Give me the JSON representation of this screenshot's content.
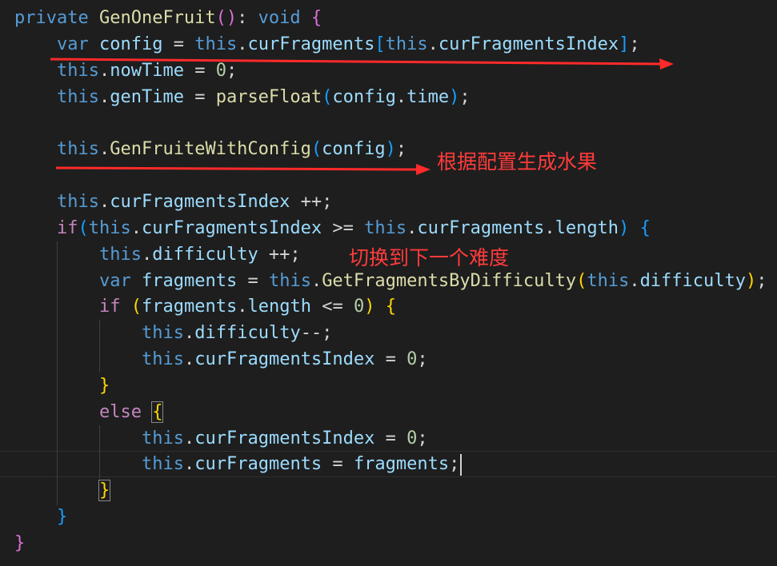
{
  "editor": {
    "lines": [
      {
        "indent": 0,
        "tokens": [
          [
            "private ",
            "kw"
          ],
          [
            "GenOneFruit",
            "fn"
          ],
          [
            "(",
            "b2"
          ],
          [
            ")",
            "b2"
          ],
          [
            ": ",
            "op"
          ],
          [
            "void ",
            "kw"
          ],
          [
            "{",
            "b2"
          ]
        ]
      },
      {
        "indent": 1,
        "tokens": [
          [
            "var ",
            "kw"
          ],
          [
            "config",
            "var"
          ],
          [
            " = ",
            "op"
          ],
          [
            "this",
            "kw"
          ],
          [
            ".",
            "op"
          ],
          [
            "curFragments",
            "var"
          ],
          [
            "[",
            "b3"
          ],
          [
            "this",
            "kw"
          ],
          [
            ".",
            "op"
          ],
          [
            "curFragmentsIndex",
            "var"
          ],
          [
            "]",
            "b3"
          ],
          [
            ";",
            "op"
          ]
        ]
      },
      {
        "indent": 1,
        "tokens": [
          [
            "this",
            "kw"
          ],
          [
            ".",
            "op"
          ],
          [
            "nowTime",
            "var"
          ],
          [
            " = ",
            "op"
          ],
          [
            "0",
            "num"
          ],
          [
            ";",
            "op"
          ]
        ]
      },
      {
        "indent": 1,
        "tokens": [
          [
            "this",
            "kw"
          ],
          [
            ".",
            "op"
          ],
          [
            "genTime",
            "var"
          ],
          [
            " = ",
            "op"
          ],
          [
            "parseFloat",
            "fn"
          ],
          [
            "(",
            "b3"
          ],
          [
            "config",
            "var"
          ],
          [
            ".",
            "op"
          ],
          [
            "time",
            "var"
          ],
          [
            ")",
            "b3"
          ],
          [
            ";",
            "op"
          ]
        ]
      },
      {
        "indent": 0,
        "tokens": []
      },
      {
        "indent": 1,
        "tokens": [
          [
            "this",
            "kw"
          ],
          [
            ".",
            "op"
          ],
          [
            "GenFruiteWithConfig",
            "fn"
          ],
          [
            "(",
            "b3"
          ],
          [
            "config",
            "var"
          ],
          [
            ")",
            "b3"
          ],
          [
            ";",
            "op"
          ]
        ]
      },
      {
        "indent": 0,
        "tokens": []
      },
      {
        "indent": 1,
        "tokens": [
          [
            "this",
            "kw"
          ],
          [
            ".",
            "op"
          ],
          [
            "curFragmentsIndex",
            "var"
          ],
          [
            " ++;",
            "op"
          ]
        ]
      },
      {
        "indent": 1,
        "tokens": [
          [
            "if",
            "ctl"
          ],
          [
            "(",
            "b3"
          ],
          [
            "this",
            "kw"
          ],
          [
            ".",
            "op"
          ],
          [
            "curFragmentsIndex",
            "var"
          ],
          [
            " >= ",
            "op"
          ],
          [
            "this",
            "kw"
          ],
          [
            ".",
            "op"
          ],
          [
            "curFragments",
            "var"
          ],
          [
            ".",
            "op"
          ],
          [
            "length",
            "var"
          ],
          [
            ")",
            "b3"
          ],
          [
            " ",
            "op"
          ],
          [
            "{",
            "b3"
          ]
        ]
      },
      {
        "indent": 2,
        "tokens": [
          [
            "this",
            "kw"
          ],
          [
            ".",
            "op"
          ],
          [
            "difficulty",
            "var"
          ],
          [
            " ++;",
            "op"
          ]
        ]
      },
      {
        "indent": 2,
        "tokens": [
          [
            "var ",
            "kw"
          ],
          [
            "fragments",
            "var"
          ],
          [
            " = ",
            "op"
          ],
          [
            "this",
            "kw"
          ],
          [
            ".",
            "op"
          ],
          [
            "GetFragmentsByDifficulty",
            "fn"
          ],
          [
            "(",
            "b1"
          ],
          [
            "this",
            "kw"
          ],
          [
            ".",
            "op"
          ],
          [
            "difficulty",
            "var"
          ],
          [
            ")",
            "b1"
          ],
          [
            ";",
            "op"
          ]
        ]
      },
      {
        "indent": 2,
        "tokens": [
          [
            "if ",
            "ctl"
          ],
          [
            "(",
            "b1"
          ],
          [
            "fragments",
            "var"
          ],
          [
            ".",
            "op"
          ],
          [
            "length",
            "var"
          ],
          [
            " <= ",
            "op"
          ],
          [
            "0",
            "num"
          ],
          [
            ")",
            "b1"
          ],
          [
            " ",
            "op"
          ],
          [
            "{",
            "b1"
          ]
        ]
      },
      {
        "indent": 3,
        "tokens": [
          [
            "this",
            "kw"
          ],
          [
            ".",
            "op"
          ],
          [
            "difficulty",
            "var"
          ],
          [
            "--;",
            "op"
          ]
        ]
      },
      {
        "indent": 3,
        "tokens": [
          [
            "this",
            "kw"
          ],
          [
            ".",
            "op"
          ],
          [
            "curFragmentsIndex",
            "var"
          ],
          [
            " = ",
            "op"
          ],
          [
            "0",
            "num"
          ],
          [
            ";",
            "op"
          ]
        ]
      },
      {
        "indent": 2,
        "tokens": [
          [
            "}",
            "b1"
          ]
        ]
      },
      {
        "indent": 2,
        "tokens": [
          [
            "else ",
            "ctl"
          ],
          [
            "{",
            "b1",
            "bm"
          ]
        ]
      },
      {
        "indent": 3,
        "tokens": [
          [
            "this",
            "kw"
          ],
          [
            ".",
            "op"
          ],
          [
            "curFragmentsIndex",
            "var"
          ],
          [
            " = ",
            "op"
          ],
          [
            "0",
            "num"
          ],
          [
            ";",
            "op"
          ]
        ]
      },
      {
        "indent": 3,
        "tokens": [
          [
            "this",
            "kw"
          ],
          [
            ".",
            "op"
          ],
          [
            "curFragments",
            "var"
          ],
          [
            " = ",
            "op"
          ],
          [
            "fragments",
            "var"
          ],
          [
            ";",
            "op"
          ]
        ],
        "cursor": true
      },
      {
        "indent": 2,
        "tokens": [
          [
            "}",
            "b1",
            "bm"
          ]
        ]
      },
      {
        "indent": 1,
        "tokens": [
          [
            "}",
            "b3"
          ]
        ]
      },
      {
        "indent": 0,
        "tokens": [
          [
            "}",
            "b2"
          ]
        ]
      }
    ]
  },
  "annotations": [
    {
      "label": "根据配置生成水果"
    },
    {
      "label": "切换到下一个难度"
    }
  ],
  "colors": {
    "background": "#1e1e1e",
    "keyword": "#569cd6",
    "control": "#c586c0",
    "function": "#dcdcaa",
    "variable": "#9cdcfe",
    "number": "#b5cea8",
    "annotation": "#ff3b3b"
  }
}
